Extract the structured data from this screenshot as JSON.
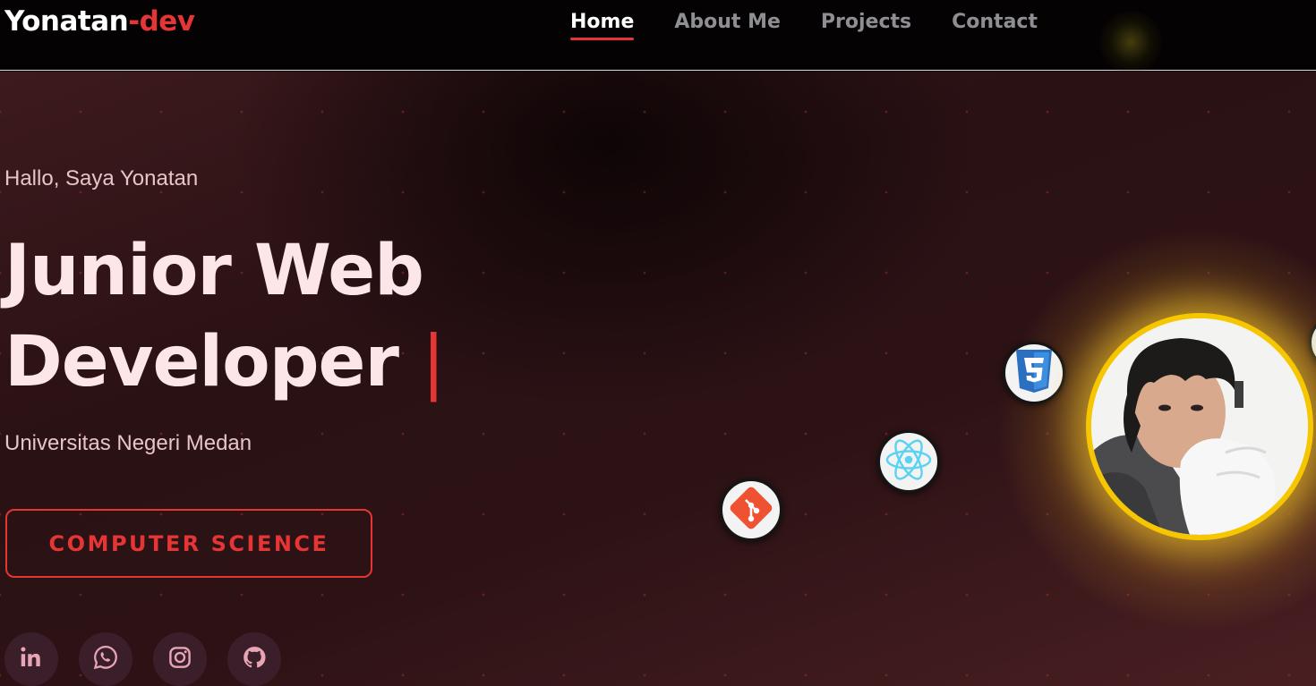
{
  "header": {
    "logo_main": "Yonatan",
    "logo_accent": "-dev",
    "nav": [
      {
        "label": "Home",
        "active": true
      },
      {
        "label": "About Me",
        "active": false
      },
      {
        "label": "Projects",
        "active": false
      },
      {
        "label": "Contact",
        "active": false
      }
    ]
  },
  "hero": {
    "greeting": "Hallo, Saya Yonatan",
    "title_line1": "Junior Web",
    "title_line2": "Developer",
    "cursor": "|",
    "university": "Universitas Negeri Medan",
    "cta_label": "COMPUTER SCIENCE"
  },
  "socials": [
    {
      "icon": "linkedin-icon"
    },
    {
      "icon": "whatsapp-icon"
    },
    {
      "icon": "instagram-icon"
    },
    {
      "icon": "github-icon"
    }
  ],
  "tech_icons": [
    "git-icon",
    "react-icon",
    "css3-icon"
  ],
  "colors": {
    "accent": "#e53535",
    "avatar_ring": "#f6c700",
    "nav_bg": "#050203",
    "text_light": "#fde6e7",
    "muted_nav": "#8f8f93"
  }
}
